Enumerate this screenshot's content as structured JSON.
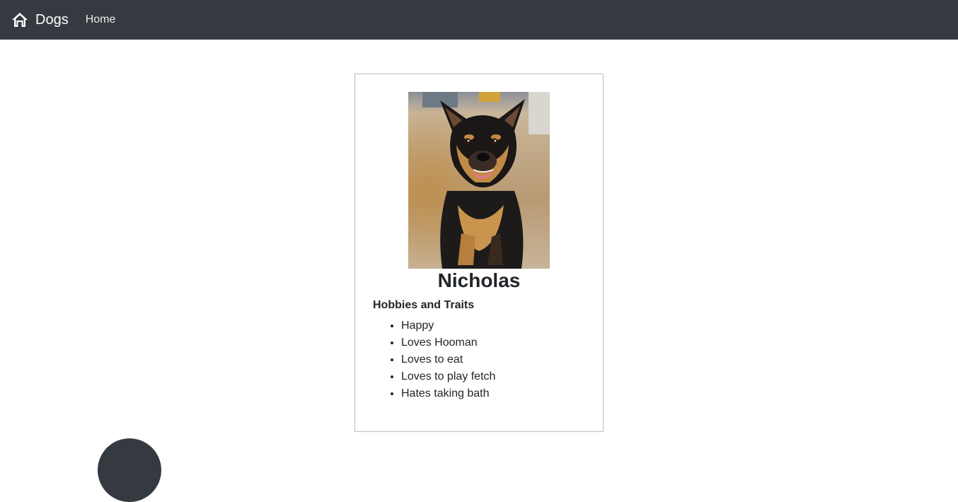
{
  "navbar": {
    "brand_label": "Dogs",
    "brand_icon": "home-icon",
    "links": [
      {
        "label": "Home"
      }
    ],
    "background": "#343a40"
  },
  "dog": {
    "name": "Nicholas",
    "photo_icon": "dog-photo",
    "traits_heading": "Hobbies and Traits",
    "traits": [
      "Happy",
      "Loves Hooman",
      "Loves to eat",
      "Loves to play fetch",
      "Hates taking bath"
    ]
  },
  "colors": {
    "navbar_bg": "#343a40",
    "text": "#212529",
    "card_border": "#bdbdbd"
  }
}
